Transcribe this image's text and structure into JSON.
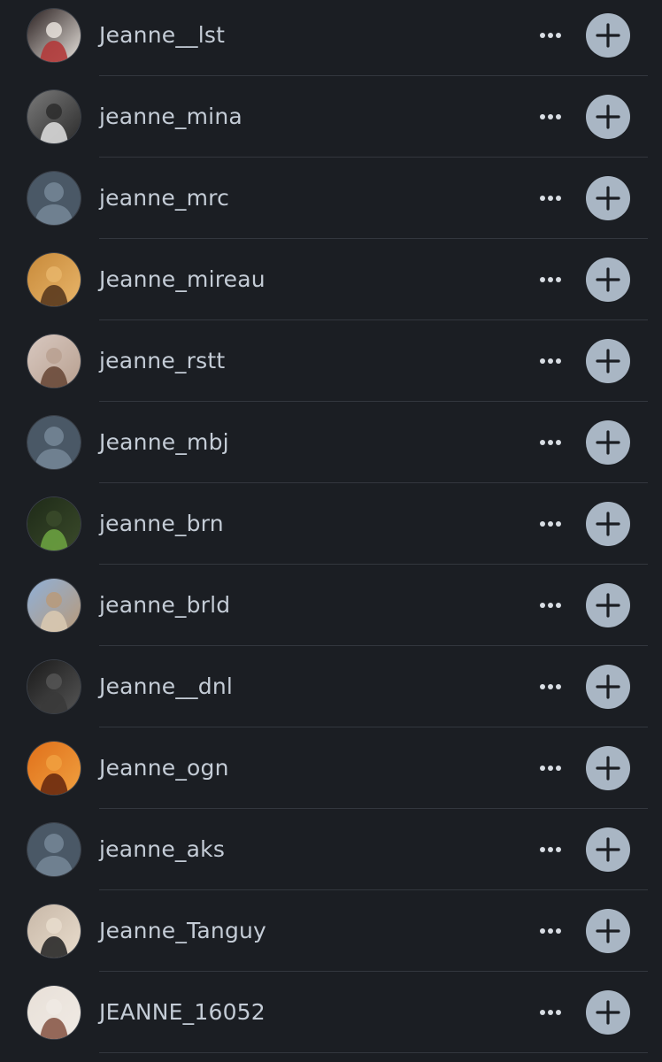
{
  "colors": {
    "background": "#1b1e23",
    "username_text": "#c4ccd6",
    "add_button": "#a9b6c4",
    "divider": "#33373e",
    "placeholder_avatar_bg": "#4a5866",
    "placeholder_avatar_fg": "#6f8090"
  },
  "icons": {
    "more": "more-horizontal-icon",
    "add": "plus-icon",
    "placeholder": "default-avatar-icon"
  },
  "users": [
    {
      "username": "Jeanne__lst",
      "avatar": "photo",
      "palette": [
        "#2a2020",
        "#b23a3a",
        "#e7e2dc"
      ]
    },
    {
      "username": "jeanne_mina",
      "avatar": "photo",
      "palette": [
        "#7a7a7a",
        "#d8d8d8",
        "#2b2b2b"
      ]
    },
    {
      "username": "jeanne_mrc",
      "avatar": "placeholder",
      "palette": []
    },
    {
      "username": "Jeanne_mireau",
      "avatar": "photo",
      "palette": [
        "#c88a3a",
        "#5a3a1e",
        "#e8b56a"
      ]
    },
    {
      "username": "jeanne_rstt",
      "avatar": "photo",
      "palette": [
        "#d8c8c0",
        "#6a4a3a",
        "#b8a090"
      ]
    },
    {
      "username": "Jeanne_mbj",
      "avatar": "placeholder",
      "palette": []
    },
    {
      "username": "jeanne_brn",
      "avatar": "photo",
      "palette": [
        "#1e2a18",
        "#6aa040",
        "#3a4a2a"
      ]
    },
    {
      "username": "jeanne_brld",
      "avatar": "photo",
      "palette": [
        "#8fb0d8",
        "#d8c8b0",
        "#b89a7a"
      ]
    },
    {
      "username": "Jeanne__dnl",
      "avatar": "photo",
      "palette": [
        "#1a1a1a",
        "#3a3a3a",
        "#555555"
      ]
    },
    {
      "username": "Jeanne_ogn",
      "avatar": "photo",
      "palette": [
        "#e0701a",
        "#6a2a10",
        "#f0a040"
      ]
    },
    {
      "username": "jeanne_aks",
      "avatar": "placeholder",
      "palette": []
    },
    {
      "username": "Jeanne_Tanguy",
      "avatar": "photo",
      "palette": [
        "#c8b8a8",
        "#2a2a2a",
        "#e8dccc"
      ]
    },
    {
      "username": "JEANNE_16052",
      "avatar": "photo",
      "palette": [
        "#e8e0d8",
        "#8a5a4a",
        "#f0eae4"
      ]
    }
  ]
}
